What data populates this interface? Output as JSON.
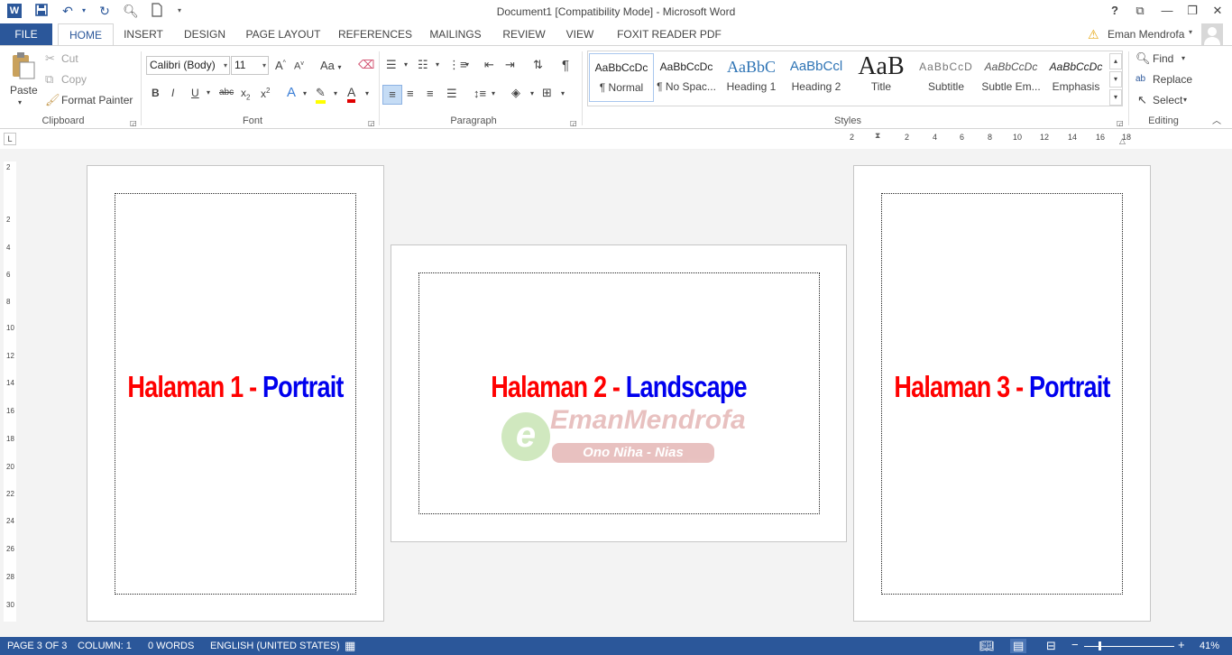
{
  "window": {
    "title": "Document1 [Compatibility Mode] - Microsoft Word",
    "user": "Eman Mendrofa",
    "help": "?"
  },
  "tabs": [
    "FILE",
    "HOME",
    "INSERT",
    "DESIGN",
    "PAGE LAYOUT",
    "REFERENCES",
    "MAILINGS",
    "REVIEW",
    "VIEW",
    "FOXIT READER PDF"
  ],
  "clipboard": {
    "paste": "Paste",
    "cut": "Cut",
    "copy": "Copy",
    "format_painter": "Format Painter",
    "label": "Clipboard"
  },
  "font": {
    "family": "Calibri (Body)",
    "size": "11",
    "grow": "A",
    "change_case": "Aa",
    "bold": "B",
    "italic": "I",
    "underline": "U",
    "strike": "abc",
    "subscript": "x",
    "subscript_mark": "2",
    "superscript": "x",
    "superscript_mark": "2",
    "label": "Font"
  },
  "paragraph": {
    "label": "Paragraph",
    "pilcrow": "¶"
  },
  "styles": {
    "label": "Styles",
    "items": [
      {
        "preview": "AaBbCcDc",
        "label": "¶ Normal"
      },
      {
        "preview": "AaBbCcDc",
        "label": "¶ No Spac..."
      },
      {
        "preview": "AaBbC",
        "label": "Heading 1"
      },
      {
        "preview": "AaBbCcl",
        "label": "Heading 2"
      },
      {
        "preview": "AaB",
        "label": "Title"
      },
      {
        "preview": "AaBbCcD",
        "label": "Subtitle"
      },
      {
        "preview": "AaBbCcDc",
        "label": "Subtle Em..."
      },
      {
        "preview": "AaBbCcDc",
        "label": "Emphasis"
      }
    ]
  },
  "editing": {
    "find": "Find",
    "replace": "Replace",
    "select": "Select",
    "label": "Editing"
  },
  "hruler_ticks": [
    "2",
    "2",
    "4",
    "6",
    "8",
    "10",
    "12",
    "14",
    "16",
    "18"
  ],
  "vruler_ticks": [
    "2",
    "2",
    "4",
    "6",
    "8",
    "10",
    "12",
    "14",
    "16",
    "18",
    "20",
    "22",
    "24",
    "26",
    "28",
    "30"
  ],
  "pages": [
    {
      "num": "Halaman 1",
      "dash": " - ",
      "orient": "Portrait"
    },
    {
      "num": "Halaman 2",
      "dash": " - ",
      "orient": "Landscape"
    },
    {
      "num": "Halaman 3",
      "dash": " - ",
      "orient": "Portrait"
    }
  ],
  "watermark": {
    "line1": "EmanMendrofa",
    "line2": "Ono Niha - Nias"
  },
  "status": {
    "page": "PAGE 3 OF 3",
    "column": "COLUMN: 1",
    "words": "0 WORDS",
    "language": "ENGLISH (UNITED STATES)",
    "zoom": "41%",
    "zoom_level": 0.41
  }
}
